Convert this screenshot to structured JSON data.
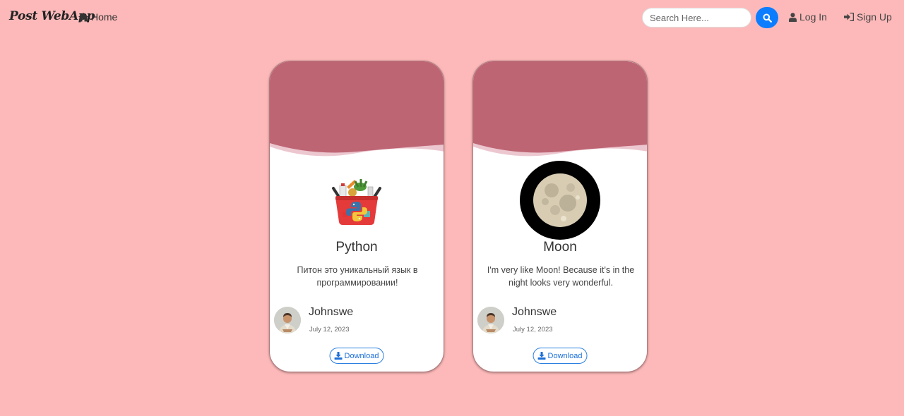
{
  "navbar": {
    "brand": "Post WebApp",
    "home_label": "Home",
    "search_placeholder": "Search Here...",
    "search_value": "",
    "login_label": "Log In",
    "signup_label": "Sign Up"
  },
  "posts": [
    {
      "title": "Python",
      "description": "Питон это уникальный язык в программировании!",
      "image": "python-basket-image",
      "author": "Johnswe",
      "date": "July 12, 2023",
      "download_label": "Download"
    },
    {
      "title": "Moon",
      "description": "I'm very like Moon! Because it's in the night looks very wonderful.",
      "image": "moon-image",
      "author": "Johnswe",
      "date": "July 12, 2023",
      "download_label": "Download"
    }
  ],
  "colors": {
    "background": "#fdb9b9",
    "card_header": "#be6574",
    "accent_blue": "#0d7dff"
  },
  "icons": {
    "home": "home-icon",
    "search": "search-icon",
    "login": "user-icon",
    "signup": "sign-in-icon",
    "download": "download-icon"
  }
}
